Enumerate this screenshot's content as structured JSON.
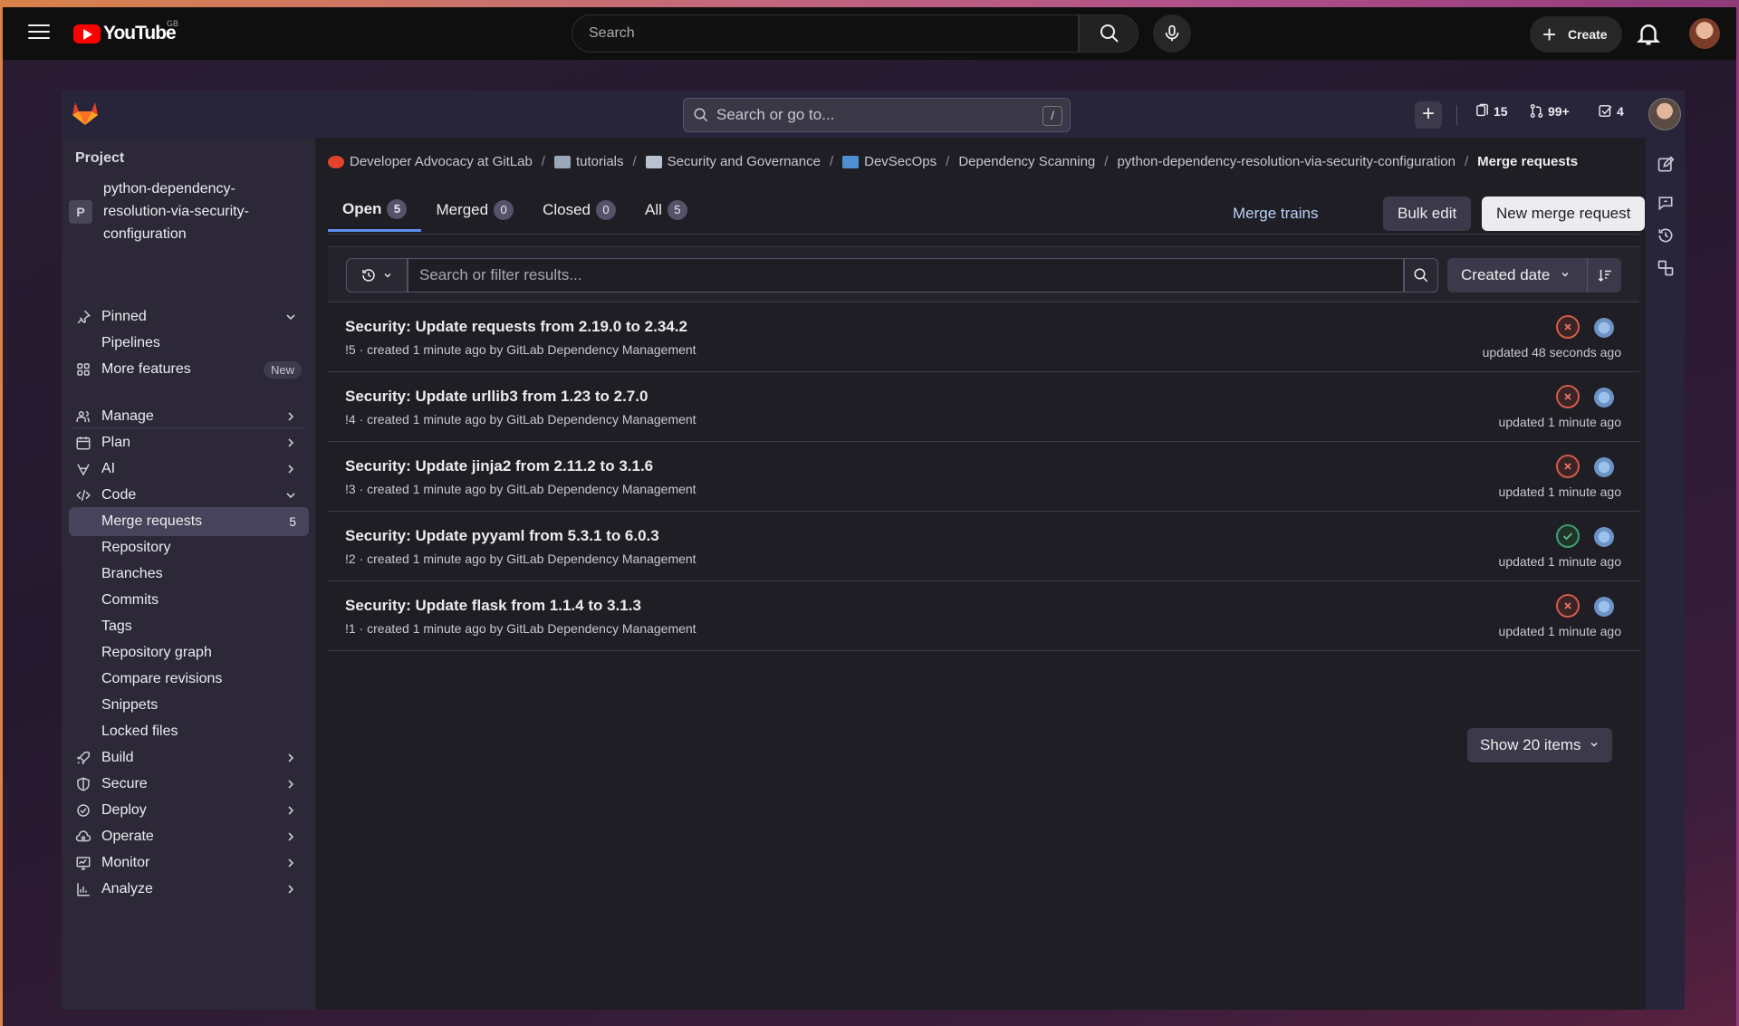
{
  "youtube": {
    "logo_text": "YouTube",
    "region": "GB",
    "search_placeholder": "Search",
    "create_label": "Create"
  },
  "gitlab_header": {
    "search_placeholder": "Search or go to...",
    "search_shortcut": "/",
    "issues_count": "15",
    "merge_requests_count": "99+",
    "todos_count": "4"
  },
  "sidebar": {
    "heading": "Project",
    "project_initial": "P",
    "project_name": "python-dependency-resolution-via-security-configuration",
    "items": [
      {
        "label": "Pinned",
        "icon": "pin-icon",
        "chevron": "down"
      },
      {
        "label": "Pipelines",
        "icon": "",
        "chevron": ""
      },
      {
        "label": "More features",
        "icon": "apps-icon",
        "badge": "New"
      },
      {
        "label": "Manage",
        "icon": "users-icon",
        "chevron": "right"
      },
      {
        "label": "Plan",
        "icon": "calendar-icon",
        "chevron": "right"
      },
      {
        "label": "AI",
        "icon": "tanuki-ai-icon",
        "chevron": "right"
      },
      {
        "label": "Code",
        "icon": "code-icon",
        "chevron": "down"
      },
      {
        "label": "Merge requests",
        "count": "5",
        "active": true
      },
      {
        "label": "Repository"
      },
      {
        "label": "Branches"
      },
      {
        "label": "Commits"
      },
      {
        "label": "Tags"
      },
      {
        "label": "Repository graph"
      },
      {
        "label": "Compare revisions"
      },
      {
        "label": "Snippets"
      },
      {
        "label": "Locked files"
      },
      {
        "label": "Build",
        "icon": "rocket-icon",
        "chevron": "right"
      },
      {
        "label": "Secure",
        "icon": "shield-icon",
        "chevron": "right"
      },
      {
        "label": "Deploy",
        "icon": "deploy-icon",
        "chevron": "right"
      },
      {
        "label": "Operate",
        "icon": "cloud-gear-icon",
        "chevron": "right"
      },
      {
        "label": "Monitor",
        "icon": "monitor-icon",
        "chevron": "right"
      },
      {
        "label": "Analyze",
        "icon": "chart-icon",
        "chevron": "right"
      }
    ]
  },
  "breadcrumbs": [
    "Developer Advocacy at GitLab",
    "tutorials",
    "Security and Governance",
    "DevSecOps",
    "Dependency Scanning",
    "python-dependency-resolution-via-security-configuration",
    "Merge requests"
  ],
  "tabs": [
    {
      "label": "Open",
      "count": "5",
      "active": true
    },
    {
      "label": "Merged",
      "count": "0"
    },
    {
      "label": "Closed",
      "count": "0"
    },
    {
      "label": "All",
      "count": "5"
    }
  ],
  "actions": {
    "merge_trains": "Merge trains",
    "bulk_edit": "Bulk edit",
    "new_mr": "New merge request"
  },
  "filter": {
    "placeholder": "Search or filter results...",
    "sort_label": "Created date"
  },
  "merge_requests": [
    {
      "title": "Security: Update requests from 2.19.0 to 2.34.2",
      "meta": "!5 · created 1 minute ago by GitLab Dependency Management",
      "updated": "updated 48 seconds ago",
      "status": "failed"
    },
    {
      "title": "Security: Update urllib3 from 1.23 to 2.7.0",
      "meta": "!4 · created 1 minute ago by GitLab Dependency Management",
      "updated": "updated 1 minute ago",
      "status": "failed"
    },
    {
      "title": "Security: Update jinja2 from 2.11.2 to 3.1.6",
      "meta": "!3 · created 1 minute ago by GitLab Dependency Management",
      "updated": "updated 1 minute ago",
      "status": "failed"
    },
    {
      "title": "Security: Update pyyaml from 5.3.1 to 6.0.3",
      "meta": "!2 · created 1 minute ago by GitLab Dependency Management",
      "updated": "updated 1 minute ago",
      "status": "passed"
    },
    {
      "title": "Security: Update flask from 1.1.4 to 3.1.3",
      "meta": "!1 · created 1 minute ago by GitLab Dependency Management",
      "updated": "updated 1 minute ago",
      "status": "failed"
    }
  ],
  "pagination": {
    "show_items": "Show 20 items"
  },
  "colors": {
    "failed": "#d45c4a",
    "passed": "#3e9e72",
    "active_tab": "#5c90ec"
  }
}
